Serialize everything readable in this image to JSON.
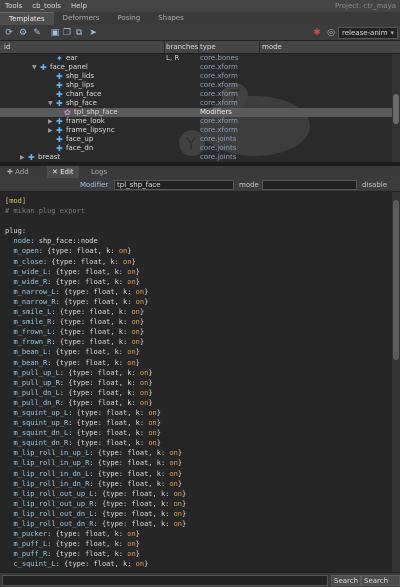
{
  "menu": {
    "items": [
      "Tools",
      "cb_tools",
      "Help"
    ],
    "project": "Project: ctr_maya"
  },
  "tabs": [
    "Templates",
    "Deformers",
    "Posing",
    "Shapes"
  ],
  "toolbar": {
    "env_select": "release-anim"
  },
  "tree": {
    "columns": {
      "id": "id",
      "branches": "branches",
      "type": "type",
      "mode": "mode"
    },
    "rows": [
      {
        "label": "ear",
        "branches": "L, R",
        "type": "core.bones",
        "icon": "bone",
        "twist": "",
        "selected": false
      },
      {
        "label": "face_panel",
        "branches": "",
        "type": "core.xform",
        "icon": "xform",
        "twist": "▼",
        "selected": false
      },
      {
        "label": "shp_lids",
        "branches": "",
        "type": "core.xform",
        "icon": "xform",
        "twist": "",
        "selected": false
      },
      {
        "label": "shp_lips",
        "branches": "",
        "type": "core.xform",
        "icon": "xform",
        "twist": "",
        "selected": false
      },
      {
        "label": "chan_face",
        "branches": "",
        "type": "core.xform",
        "icon": "xform",
        "twist": "",
        "selected": false
      },
      {
        "label": "shp_face",
        "branches": "",
        "type": "core.xform",
        "icon": "xform",
        "twist": "▼",
        "selected": false
      },
      {
        "label": "tpl_shp_face",
        "branches": "",
        "type": "Modifiers",
        "icon": "modifier",
        "twist": "",
        "selected": true
      },
      {
        "label": "frame_look",
        "branches": "",
        "type": "core.xform",
        "icon": "xform",
        "twist": "▶",
        "selected": false
      },
      {
        "label": "frame_lipsync",
        "branches": "",
        "type": "core.xform",
        "icon": "xform",
        "twist": "▶",
        "selected": false
      },
      {
        "label": "face_up",
        "branches": "",
        "type": "core.joints",
        "icon": "xform",
        "twist": "",
        "selected": false
      },
      {
        "label": "face_dn",
        "branches": "",
        "type": "core.joints",
        "icon": "xform",
        "twist": "",
        "selected": false
      },
      {
        "label": "breast",
        "branches": "",
        "type": "core.joints",
        "icon": "xform",
        "twist": "▶",
        "selected": false
      }
    ]
  },
  "editor_tabs": {
    "add": "Add",
    "edit": "Edit",
    "logs": "Logs"
  },
  "modifier": {
    "label": "Modifier",
    "value": "tpl_shp_face",
    "mode_label": "mode",
    "mode_value": "",
    "disable_label": "disable"
  },
  "code_lines": [
    "[mod]",
    "# mikan plug export",
    "",
    "plug:",
    "  node: shp_face::node",
    "  m_open: {type: float, k: on}",
    "  m_close: {type: float, k: on}",
    "  m_wide_L: {type: float, k: on}",
    "  m_wide_R: {type: float, k: on}",
    "  m_narrow_L: {type: float, k: on}",
    "  m_narrow_R: {type: float, k: on}",
    "  m_smile_L: {type: float, k: on}",
    "  m_smile_R: {type: float, k: on}",
    "  m_frown_L: {type: float, k: on}",
    "  m_frown_R: {type: float, k: on}",
    "  m_bean_L: {type: float, k: on}",
    "  m_bean_R: {type: float, k: on}",
    "  m_pull_up_L: {type: float, k: on}",
    "  m_pull_up_R: {type: float, k: on}",
    "  m_pull_dn_L: {type: float, k: on}",
    "  m_pull_dn_R: {type: float, k: on}",
    "  m_squint_up_L: {type: float, k: on}",
    "  m_squint_up_R: {type: float, k: on}",
    "  m_squint_dn_L: {type: float, k: on}",
    "  m_squint_dn_R: {type: float, k: on}",
    "  m_lip_roll_in_up_L: {type: float, k: on}",
    "  m_lip_roll_in_up_R: {type: float, k: on}",
    "  m_lip_roll_in_dn_L: {type: float, k: on}",
    "  m_lip_roll_in_dn_R: {type: float, k: on}",
    "  m_lip_roll_out_up_L: {type: float, k: on}",
    "  m_lip_roll_out_up_R: {type: float, k: on}",
    "  m_lip_roll_out_dn_L: {type: float, k: on}",
    "  m_lip_roll_out_dn_R: {type: float, k: on}",
    "  m_pucker: {type: float, k: on}",
    "  m_puff_L: {type: float, k: on}",
    "  m_puff_R: {type: float, k: on}",
    "  c_squint_L: {type: float, k: on}"
  ],
  "search": {
    "value": "",
    "search_label": "Search",
    "search_all_label": "Search all"
  },
  "colors": {
    "selection": "#5a5a5a",
    "section": "#e0c060",
    "comment": "#7a7a7a",
    "variable": "#9cc8e0",
    "number": "#e0a050",
    "xform_icon": "#64b4ff",
    "modifier_icon": "#c090e0"
  }
}
